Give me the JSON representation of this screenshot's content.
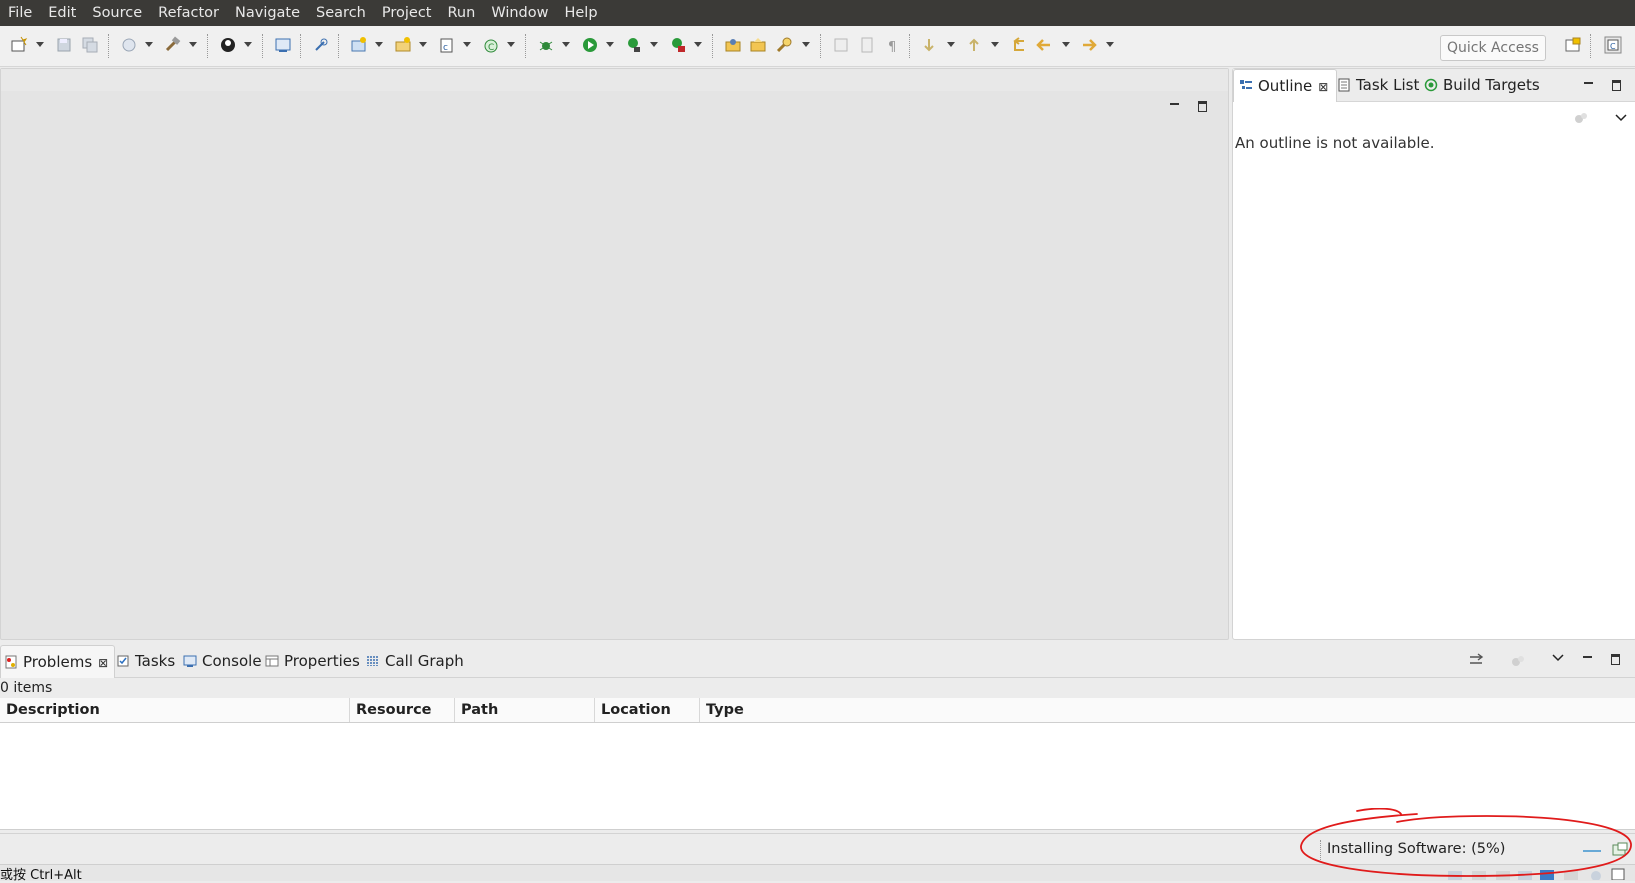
{
  "menubar": {
    "items": [
      "File",
      "Edit",
      "Source",
      "Refactor",
      "Navigate",
      "Search",
      "Project",
      "Run",
      "Window",
      "Help"
    ]
  },
  "toolbar": {
    "quick_access_placeholder": "Quick Access"
  },
  "outline": {
    "tabs": [
      "Outline",
      "Task List",
      "Build Targets"
    ],
    "message": "An outline is not available."
  },
  "problems": {
    "tabs": [
      "Problems",
      "Tasks",
      "Console",
      "Properties",
      "Call Graph"
    ],
    "items_count": "0 items",
    "columns": [
      "Description",
      "Resource",
      "Path",
      "Location",
      "Type"
    ]
  },
  "status": {
    "progress_text": "Installing Software: (5%)",
    "progress_percent": 5,
    "bottom_hint": "或按 Ctrl+Alt"
  },
  "colors": {
    "menubar_bg": "#3b3a37",
    "annotation_circle": "#e01b1b",
    "progress": "#68a9d6"
  }
}
